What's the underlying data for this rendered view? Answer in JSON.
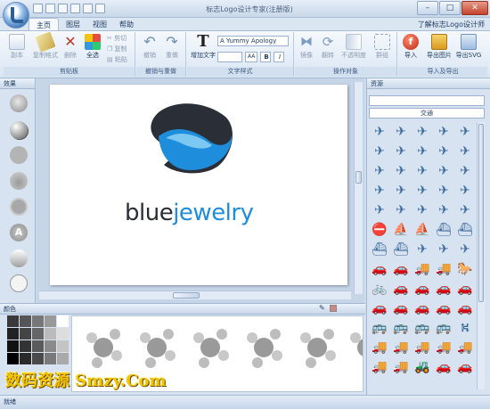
{
  "app": {
    "window_title": "标志Logo设计专家(注册版)",
    "about_link": "了解标志Logo设计师"
  },
  "tabs": [
    "主页",
    "图层",
    "视图",
    "帮助"
  ],
  "ribbon": {
    "clipboard": {
      "label": "剪贴板",
      "copy": "副本",
      "copy_format": "复制格式",
      "delete": "删除",
      "select_all": "全选",
      "cut": "剪切",
      "paste_copy": "复制",
      "paste": "粘贴"
    },
    "undo_group": {
      "label": "撤销与重做",
      "undo": "撤销",
      "redo": "重做"
    },
    "text_group": {
      "label": "文字样式",
      "add_text": "增加文字",
      "font_name": "A Yummy Apology",
      "bold": "B",
      "italic": "I"
    },
    "ops_group": {
      "label": "操作对象",
      "mirror": "镜像",
      "flip": "翻转",
      "opacity": "不透明度",
      "group": "群组"
    },
    "io_group": {
      "label": "导入及导出",
      "import": "导入",
      "export_image": "导出图片",
      "export_svg": "导出SVG"
    }
  },
  "left_panel": {
    "title": "效果"
  },
  "canvas": {
    "logo_text_part1": "blue",
    "logo_text_part2": "jewelry"
  },
  "right_panel": {
    "title": "资源",
    "category": "交通"
  },
  "bottom_panel": {
    "title": "颜色"
  },
  "status": {
    "text": "就绪"
  },
  "watermark": "数码资源 Smzy.Com",
  "colors": {
    "accent": "#3f78b8",
    "logo_blue": "#1e8ddb",
    "logo_dark": "#2a2f37"
  }
}
